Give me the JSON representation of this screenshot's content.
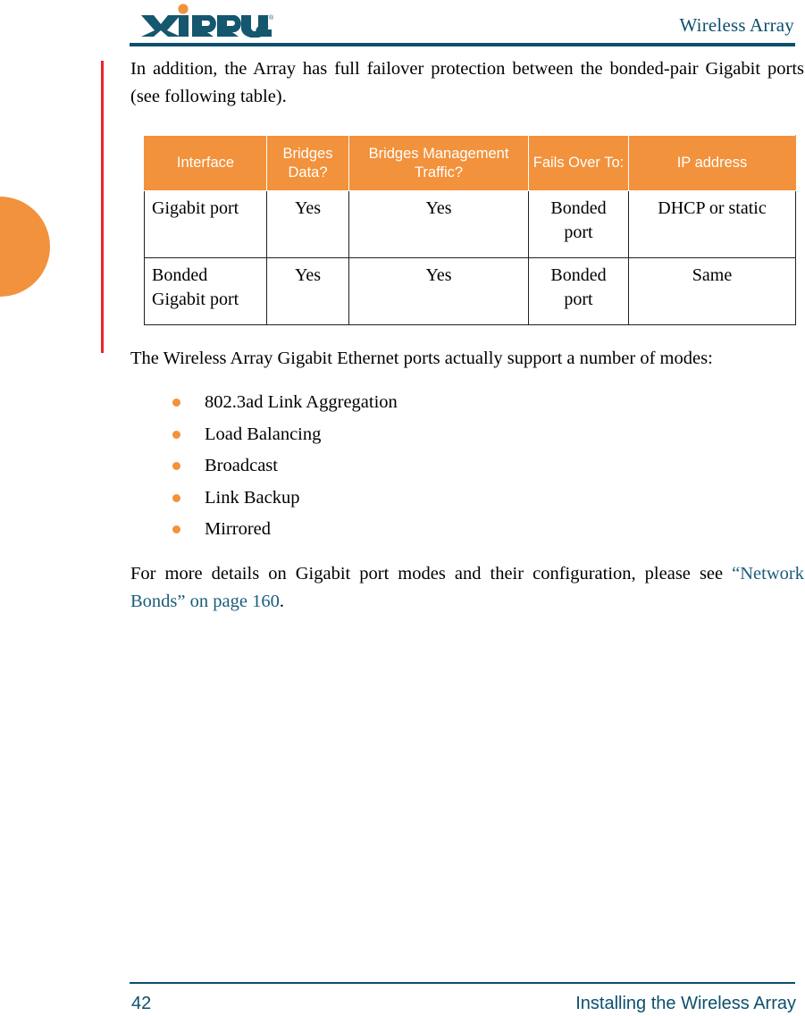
{
  "header": {
    "logo_text": "XIRRUS",
    "logo_trademark": "®",
    "title": "Wireless Array"
  },
  "content": {
    "intro_paragraph": "In addition, the Array has full failover protection between the bonded-pair Gigabit ports (see following table).",
    "modes_intro": "The Wireless Array Gigabit Ethernet ports actually support a number of modes:",
    "closing_paragraph_before_link": "For more details on Gigabit port modes and their configuration, please see ",
    "closing_link_text": "“Network Bonds” on page 160",
    "closing_paragraph_after_link": ".",
    "link_color": "#1A5C7A"
  },
  "table": {
    "headers": [
      "Interface",
      "Bridges Data?",
      "Bridges Management Traffic?",
      "Fails Over To:",
      "IP address"
    ],
    "header_bg": "#F2923C",
    "header_fg": "#FFFFFF",
    "rows": [
      {
        "interface": "Gigabit port",
        "bridges_data": "Yes",
        "bridges_management_traffic": "Yes",
        "fails_over_to": "Bonded port",
        "ip_address": "DHCP or static"
      },
      {
        "interface": "Bonded Gigabit port",
        "bridges_data": "Yes",
        "bridges_management_traffic": "Yes",
        "fails_over_to": "Bonded port",
        "ip_address": "Same"
      }
    ]
  },
  "modes": [
    "802.3ad Link Aggregation",
    "Load Balancing",
    "Broadcast",
    "Link Backup",
    "Mirrored"
  ],
  "footer": {
    "page_number": "42",
    "section_title": "Installing the Wireless Array"
  },
  "decor": {
    "accent_orange": "#F2923C",
    "accent_teal": "#0C4F6E",
    "change_bar_color": "#E8252A"
  }
}
